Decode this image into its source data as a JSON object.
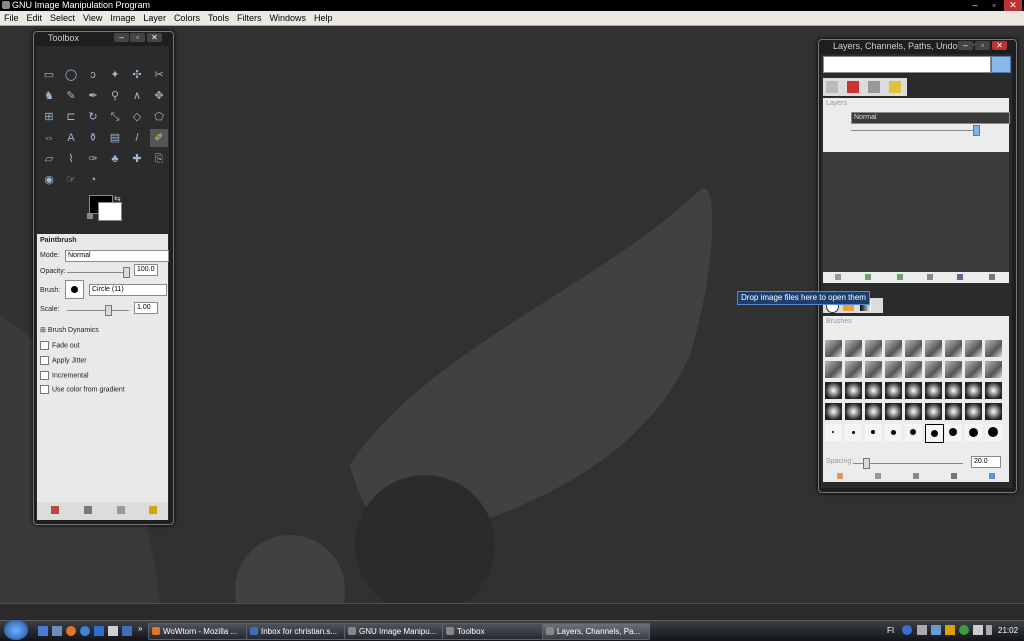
{
  "window": {
    "title": "GNU Image Manipulation Program",
    "min": "–",
    "max": "▫",
    "close": "✕"
  },
  "menu": [
    "File",
    "Edit",
    "Select",
    "View",
    "Image",
    "Layer",
    "Colors",
    "Tools",
    "Filters",
    "Windows",
    "Help"
  ],
  "toolbox": {
    "title": "Toolbox",
    "tool_options_title": "Paintbrush",
    "mode_label": "Mode:",
    "mode_value": "Normal",
    "opacity_label": "Opacity:",
    "opacity_value": "100.0",
    "brush_label": "Brush:",
    "brush_value": "Circle (11)",
    "scale_label": "Scale:",
    "scale_value": "1.00",
    "brush_dynamics": "Brush Dynamics",
    "fade_out": "Fade out",
    "apply_jitter": "Apply Jitter",
    "incremental": "Incremental",
    "use_gradient": "Use color from gradient",
    "tools": [
      "rect-select-icon",
      "ellipse-select-icon",
      "lasso-icon",
      "fuzzy-select-icon",
      "color-select-icon",
      "scissors-icon",
      "foreground-select-icon",
      "paths-icon",
      "color-picker-icon",
      "zoom-icon",
      "measure-icon",
      "move-icon",
      "align-icon",
      "crop-icon",
      "rotate-icon",
      "scale-icon",
      "shear-icon",
      "perspective-icon",
      "flip-icon",
      "text-icon",
      "bucket-fill-icon",
      "blend-icon",
      "pencil-icon",
      "paintbrush-icon",
      "eraser-icon",
      "airbrush-icon",
      "ink-icon",
      "clone-icon",
      "heal-icon",
      "perspective-clone-icon",
      "blur-icon",
      "smudge-icon",
      "dodge-burn-icon"
    ],
    "tool_glyphs": [
      "▭",
      "◯",
      "ↄ",
      "✦",
      "✣",
      "✂",
      "♞",
      "✎",
      "✒",
      "⚲",
      "∧",
      "✥",
      "⊞",
      "⊏",
      "↻",
      "⤡",
      "◇",
      "⬠",
      "⇔",
      "A",
      "⚱",
      "▤",
      "/",
      "✐",
      "▱",
      "⌇",
      "✑",
      "♣",
      "✚",
      "⎘",
      "◉",
      "☞",
      "◔"
    ]
  },
  "dock": {
    "title": "Layers, Channels, Paths, Undo - Bru...",
    "layers_title": "Layers",
    "mode_value": "Normal",
    "brushes_title": "Brushes",
    "brush_spacing_label": "Spacing:",
    "brush_spacing_value": "20.0"
  },
  "tooltip": "Drop image files here to open them",
  "taskbar": {
    "buttons": [
      "WoWtorn - Mozilla ...",
      "Inbox for christian.s...",
      "GNU Image Manipu...",
      "Toolbox",
      "Layers, Channels, Pa..."
    ],
    "language": "FI",
    "clock": "21:02"
  },
  "colors": {
    "desktop": "#313131",
    "swirl": "#3d3d3d",
    "accent": "#5b8fd6"
  }
}
